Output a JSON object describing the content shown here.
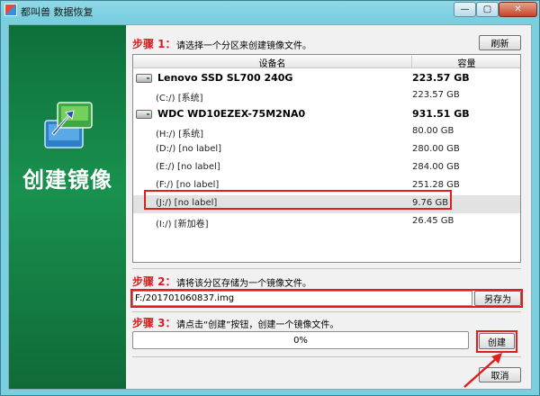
{
  "window": {
    "title": "都叫兽 数据恢复",
    "minimize_glyph": "—",
    "maximize_glyph": "▢",
    "close_glyph": "✕"
  },
  "sidebar": {
    "title": "创建镜像",
    "art_icon": "drive-copy-icon"
  },
  "step1": {
    "label": "步骤 1：",
    "text": "请选择一个分区来创建镜像文件。",
    "refresh_label": "刷新"
  },
  "table": {
    "headers": [
      "设备名",
      "容量"
    ],
    "rows": [
      {
        "kind": "disk",
        "name": "Lenovo SSD SL700 240G",
        "size": "223.57 GB"
      },
      {
        "kind": "part",
        "name": "(C:/) [系统]",
        "size": "223.57 GB"
      },
      {
        "kind": "disk",
        "name": "WDC WD10EZEX-75M2NA0",
        "size": "931.51 GB"
      },
      {
        "kind": "part",
        "name": "(H:/) [系统]",
        "size": "80.00 GB"
      },
      {
        "kind": "part",
        "name": "(D:/) [no label]",
        "size": "280.00 GB"
      },
      {
        "kind": "part",
        "name": "(E:/) [no label]",
        "size": "284.00 GB"
      },
      {
        "kind": "part",
        "name": "(F:/) [no label]",
        "size": "251.28 GB"
      },
      {
        "kind": "part",
        "name": "(J:/) [no label]",
        "size": "9.76 GB",
        "selected": true
      },
      {
        "kind": "part",
        "name": "(I:/) [新加卷]",
        "size": "26.45 GB"
      }
    ]
  },
  "step2": {
    "label": "步骤 2：",
    "text": "请将该分区存储为一个镜像文件。",
    "path_value": "F:/201701060837.img",
    "save_as_label": "另存为"
  },
  "step3": {
    "label": "步骤 3：",
    "text": "请点击“创建”按钮，创建一个镜像文件。",
    "progress_text": "0%",
    "progress_value": 0,
    "create_label": "创建"
  },
  "footer": {
    "cancel_label": "取消"
  },
  "colors": {
    "accent_red": "#e01e1e",
    "step_label": "#d42020",
    "sidebar_green": "#19914e"
  }
}
